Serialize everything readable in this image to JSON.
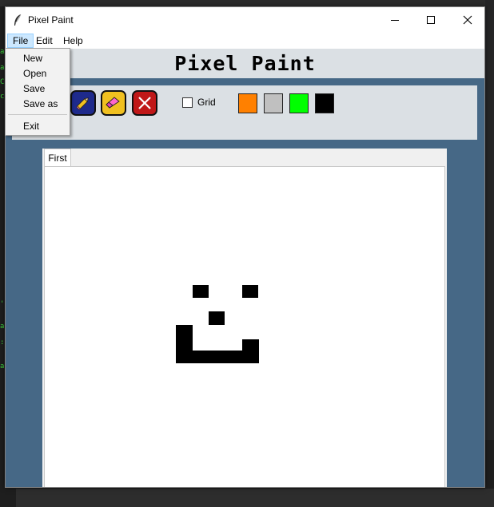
{
  "window": {
    "title": "Pixel Paint",
    "icon": "feather-icon"
  },
  "menubar": {
    "items": [
      "File",
      "Edit",
      "Help"
    ]
  },
  "file_menu": {
    "items": [
      "New",
      "Open",
      "Save",
      "Save as",
      "Exit"
    ]
  },
  "header": {
    "title": "Pixel Paint"
  },
  "toolbar": {
    "tools": [
      "pencil-icon",
      "eraser-icon",
      "clear-x-icon"
    ],
    "grid_label": "Grid",
    "grid_checked": false,
    "palette": [
      "#ff8000",
      "#c0c0c0",
      "#00ff00",
      "#000000"
    ]
  },
  "tabs": [
    "First"
  ],
  "background": {
    "terminal_chars": [
      "a",
      "a",
      "C",
      "c",
      "'",
      "a",
      ":",
      "a"
    ]
  }
}
